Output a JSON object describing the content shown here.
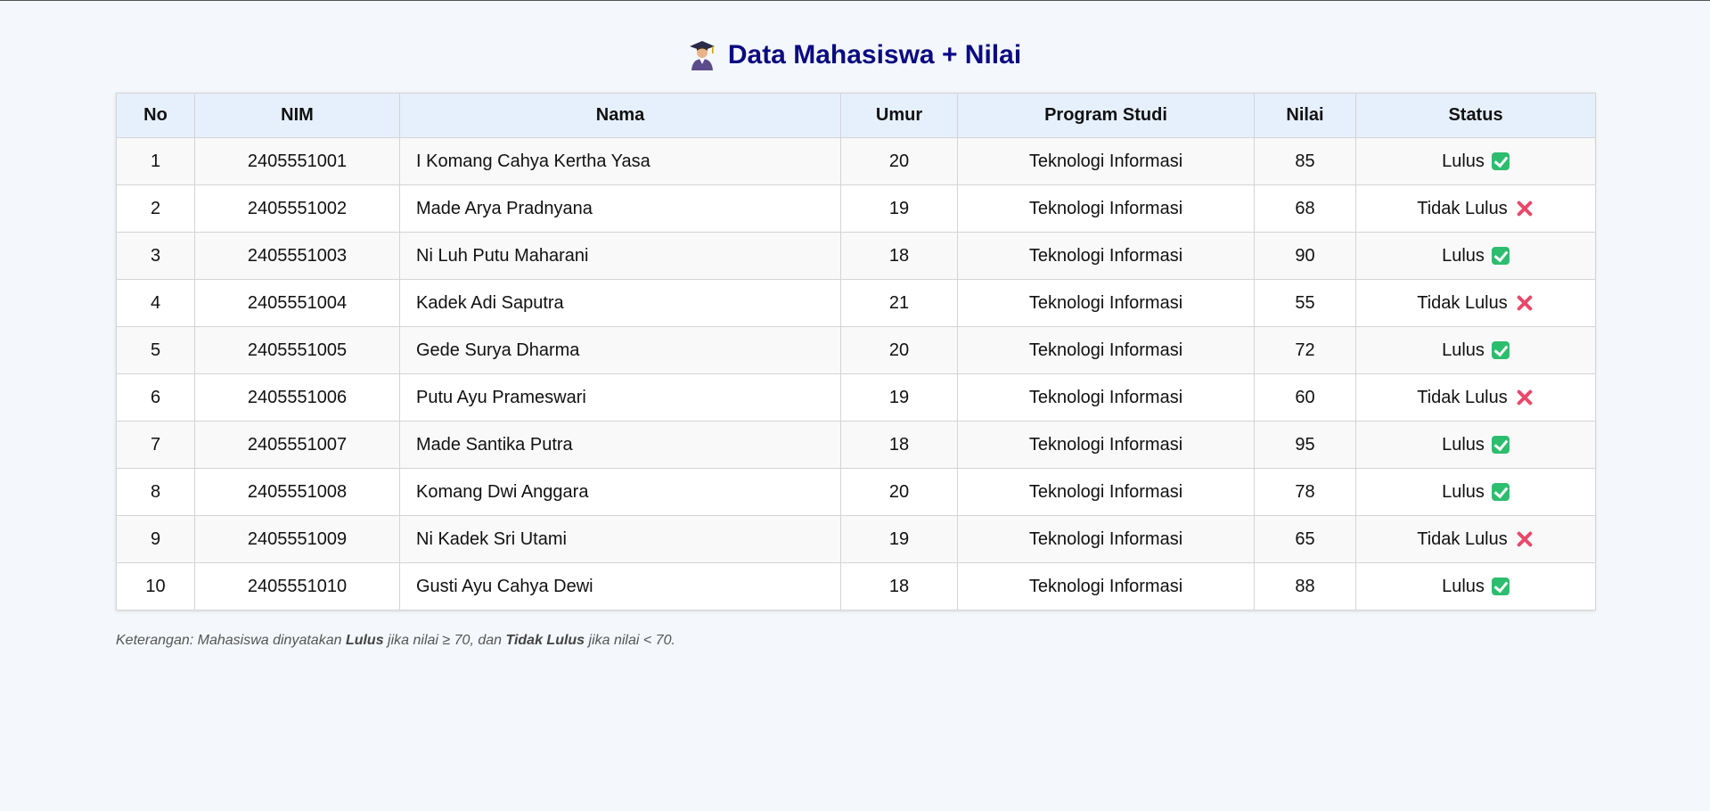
{
  "page": {
    "title": "Data Mahasiswa + Nilai",
    "title_icon": "student-graduate-icon"
  },
  "table": {
    "headers": [
      "No",
      "NIM",
      "Nama",
      "Umur",
      "Program Studi",
      "Nilai",
      "Status"
    ],
    "rows": [
      {
        "no": "1",
        "nim": "2405551001",
        "nama": "I Komang Cahya Kertha Yasa",
        "umur": "20",
        "prodi": "Teknologi Informasi",
        "nilai": "85",
        "status": "Lulus",
        "status_icon": "check-icon"
      },
      {
        "no": "2",
        "nim": "2405551002",
        "nama": "Made Arya Pradnyana",
        "umur": "19",
        "prodi": "Teknologi Informasi",
        "nilai": "68",
        "status": "Tidak Lulus",
        "status_icon": "cross-icon"
      },
      {
        "no": "3",
        "nim": "2405551003",
        "nama": "Ni Luh Putu Maharani",
        "umur": "18",
        "prodi": "Teknologi Informasi",
        "nilai": "90",
        "status": "Lulus",
        "status_icon": "check-icon"
      },
      {
        "no": "4",
        "nim": "2405551004",
        "nama": "Kadek Adi Saputra",
        "umur": "21",
        "prodi": "Teknologi Informasi",
        "nilai": "55",
        "status": "Tidak Lulus",
        "status_icon": "cross-icon"
      },
      {
        "no": "5",
        "nim": "2405551005",
        "nama": "Gede Surya Dharma",
        "umur": "20",
        "prodi": "Teknologi Informasi",
        "nilai": "72",
        "status": "Lulus",
        "status_icon": "check-icon"
      },
      {
        "no": "6",
        "nim": "2405551006",
        "nama": "Putu Ayu Prameswari",
        "umur": "19",
        "prodi": "Teknologi Informasi",
        "nilai": "60",
        "status": "Tidak Lulus",
        "status_icon": "cross-icon"
      },
      {
        "no": "7",
        "nim": "2405551007",
        "nama": "Made Santika Putra",
        "umur": "18",
        "prodi": "Teknologi Informasi",
        "nilai": "95",
        "status": "Lulus",
        "status_icon": "check-icon"
      },
      {
        "no": "8",
        "nim": "2405551008",
        "nama": "Komang Dwi Anggara",
        "umur": "20",
        "prodi": "Teknologi Informasi",
        "nilai": "78",
        "status": "Lulus",
        "status_icon": "check-icon"
      },
      {
        "no": "9",
        "nim": "2405551009",
        "nama": "Ni Kadek Sri Utami",
        "umur": "19",
        "prodi": "Teknologi Informasi",
        "nilai": "65",
        "status": "Tidak Lulus",
        "status_icon": "cross-icon"
      },
      {
        "no": "10",
        "nim": "2405551010",
        "nama": "Gusti Ayu Cahya Dewi",
        "umur": "18",
        "prodi": "Teknologi Informasi",
        "nilai": "88",
        "status": "Lulus",
        "status_icon": "check-icon"
      }
    ]
  },
  "note": {
    "prefix": "Keterangan: Mahasiswa dinyatakan ",
    "lulus": "Lulus",
    "middle": " jika nilai ≥ 70, dan ",
    "tidak_lulus": "Tidak Lulus",
    "suffix": " jika nilai < 70."
  },
  "colors": {
    "title": "#0b0b80",
    "header_bg": "#e6f0fd",
    "page_bg": "#f4f7fb",
    "pass": "#2dbd6e",
    "fail": "#e8496a"
  }
}
